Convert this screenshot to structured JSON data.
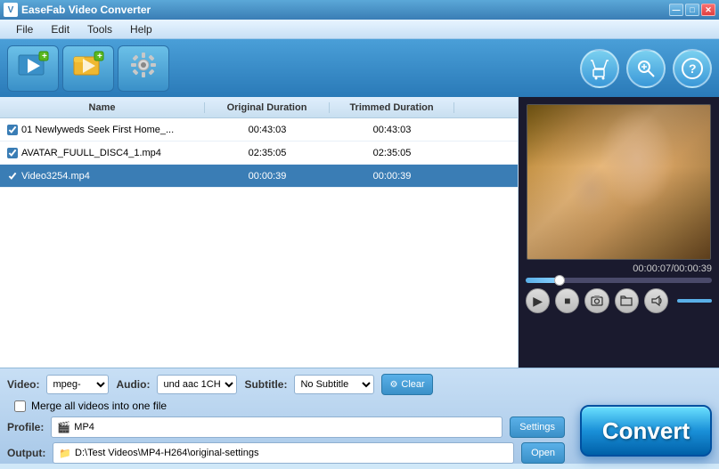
{
  "app": {
    "title": "EaseFab Video Converter",
    "icon": "V"
  },
  "window_controls": {
    "minimize": "—",
    "maximize": "□",
    "close": "✕"
  },
  "menu": {
    "items": [
      "File",
      "Edit",
      "Tools",
      "Help"
    ]
  },
  "toolbar": {
    "buttons": [
      {
        "label": "",
        "icon": "▶+",
        "name": "add-video"
      },
      {
        "label": "",
        "icon": "🎬",
        "name": "add-folder"
      },
      {
        "label": "",
        "icon": "⚙",
        "name": "settings"
      }
    ],
    "right_icons": [
      "🛒",
      "🔍",
      "⭕"
    ]
  },
  "filelist": {
    "headers": [
      "Name",
      "Original Duration",
      "Trimmed Duration"
    ],
    "rows": [
      {
        "checked": true,
        "name": "01 Newlyweds Seek First Home_...",
        "original": "00:43:03",
        "trimmed": "00:43:03",
        "selected": false
      },
      {
        "checked": true,
        "name": "AVATAR_FUULL_DISC4_1.mp4",
        "original": "02:35:05",
        "trimmed": "02:35:05",
        "selected": false
      },
      {
        "checked": true,
        "name": "Video3254.mp4",
        "original": "00:00:39",
        "trimmed": "00:00:39",
        "selected": true
      }
    ]
  },
  "preview": {
    "time_current": "00:00:07",
    "time_total": "00:00:39",
    "time_display": "00:00:07/00:00:39",
    "progress_percent": 18
  },
  "controls": {
    "video_label": "Video:",
    "video_value": "mpeg-",
    "audio_label": "Audio:",
    "audio_value": "und aac 1CH",
    "subtitle_label": "Subtitle:",
    "subtitle_value": "No Subtitle",
    "clear_label": "Clear",
    "merge_label": "Merge all videos into one file"
  },
  "profile": {
    "label": "Profile:",
    "icon": "🎬",
    "value": "MP4",
    "settings_label": "Settings"
  },
  "output": {
    "label": "Output:",
    "value": "D:\\Test Videos\\MP4-H264\\original-settings",
    "open_label": "Open"
  },
  "convert": {
    "label": "Convert"
  }
}
